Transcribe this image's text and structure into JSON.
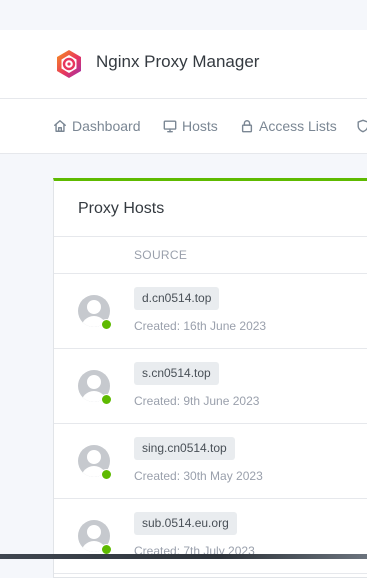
{
  "app": {
    "title": "Nginx Proxy Manager"
  },
  "nav": {
    "items": [
      {
        "label": "Dashboard",
        "icon": "home-icon"
      },
      {
        "label": "Hosts",
        "icon": "monitor-icon"
      },
      {
        "label": "Access Lists",
        "icon": "lock-icon"
      },
      {
        "label": "",
        "icon": "shield-icon"
      }
    ]
  },
  "card": {
    "title": "Proxy Hosts",
    "columns": [
      "SOURCE"
    ]
  },
  "hosts": [
    {
      "domain": "d.cn0514.top",
      "created": "Created: 16th June 2023",
      "status": "online"
    },
    {
      "domain": "s.cn0514.top",
      "created": "Created: 9th June 2023",
      "status": "online"
    },
    {
      "domain": "sing.cn0514.top",
      "created": "Created: 30th May 2023",
      "status": "online"
    },
    {
      "domain": "sub.0514.eu.org",
      "created": "Created: 7th July 2023",
      "status": "online"
    }
  ],
  "colors": {
    "accent": "#5eba00",
    "status_online": "#5eba00",
    "logo_primary": "#e8365d",
    "logo_secondary": "#f7941d"
  }
}
